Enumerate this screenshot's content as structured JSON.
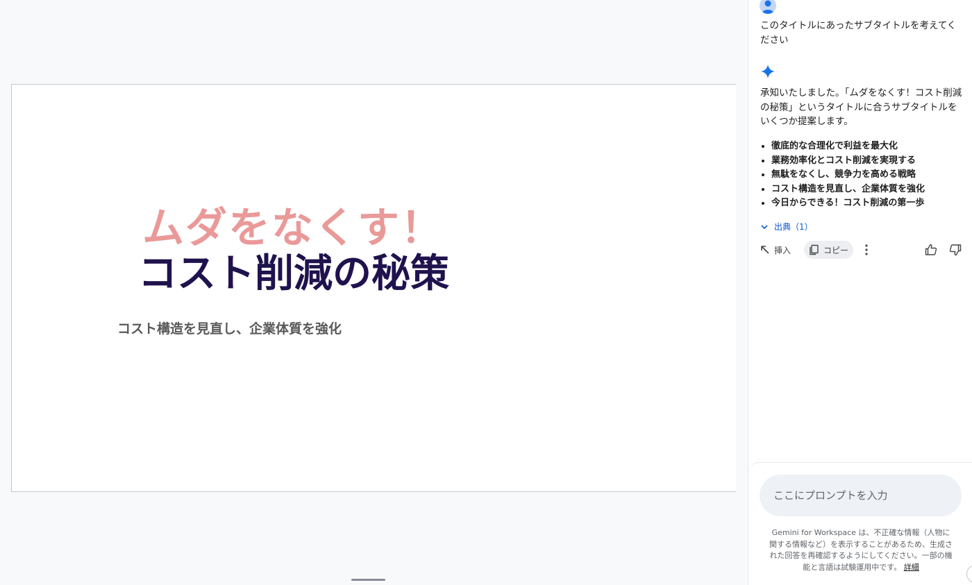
{
  "slide": {
    "title_line1": "ムダをなくす！",
    "title_line2": "コスト削減の秘策",
    "subtitle": "コスト構造を見直し、企業体質を強化"
  },
  "panel": {
    "user_message": "このタイトルにあったサブタイトルを考えてください",
    "response_intro": "承知いたしました。「ムダをなくす！コスト削減の秘策」というタイトルに合うサブタイトルをいくつか提案します。",
    "suggestions": [
      "徹底的な合理化で利益を最大化",
      "業務効率化とコスト削減を実現する",
      "無駄をなくし、競争力を高める戦略",
      "コスト構造を見直し、企業体質を強化",
      "今日からできる！コスト削減の第一歩"
    ],
    "sources_label": "出典（1）",
    "actions": {
      "insert": "挿入",
      "copy": "コピー"
    },
    "prompt_placeholder": "ここにプロンプトを入力",
    "disclaimer": "Gemini for Workspace は、不正確な情報（人物に関する情報など）を表示することがあるため、生成された回答を再確認するようにしてください。一部の機能と言語は試験運用中です。",
    "details_link": "詳細"
  },
  "colors": {
    "title_pink": "#ea9999",
    "title_navy": "#20124d",
    "accent_blue": "#0b57d0"
  }
}
